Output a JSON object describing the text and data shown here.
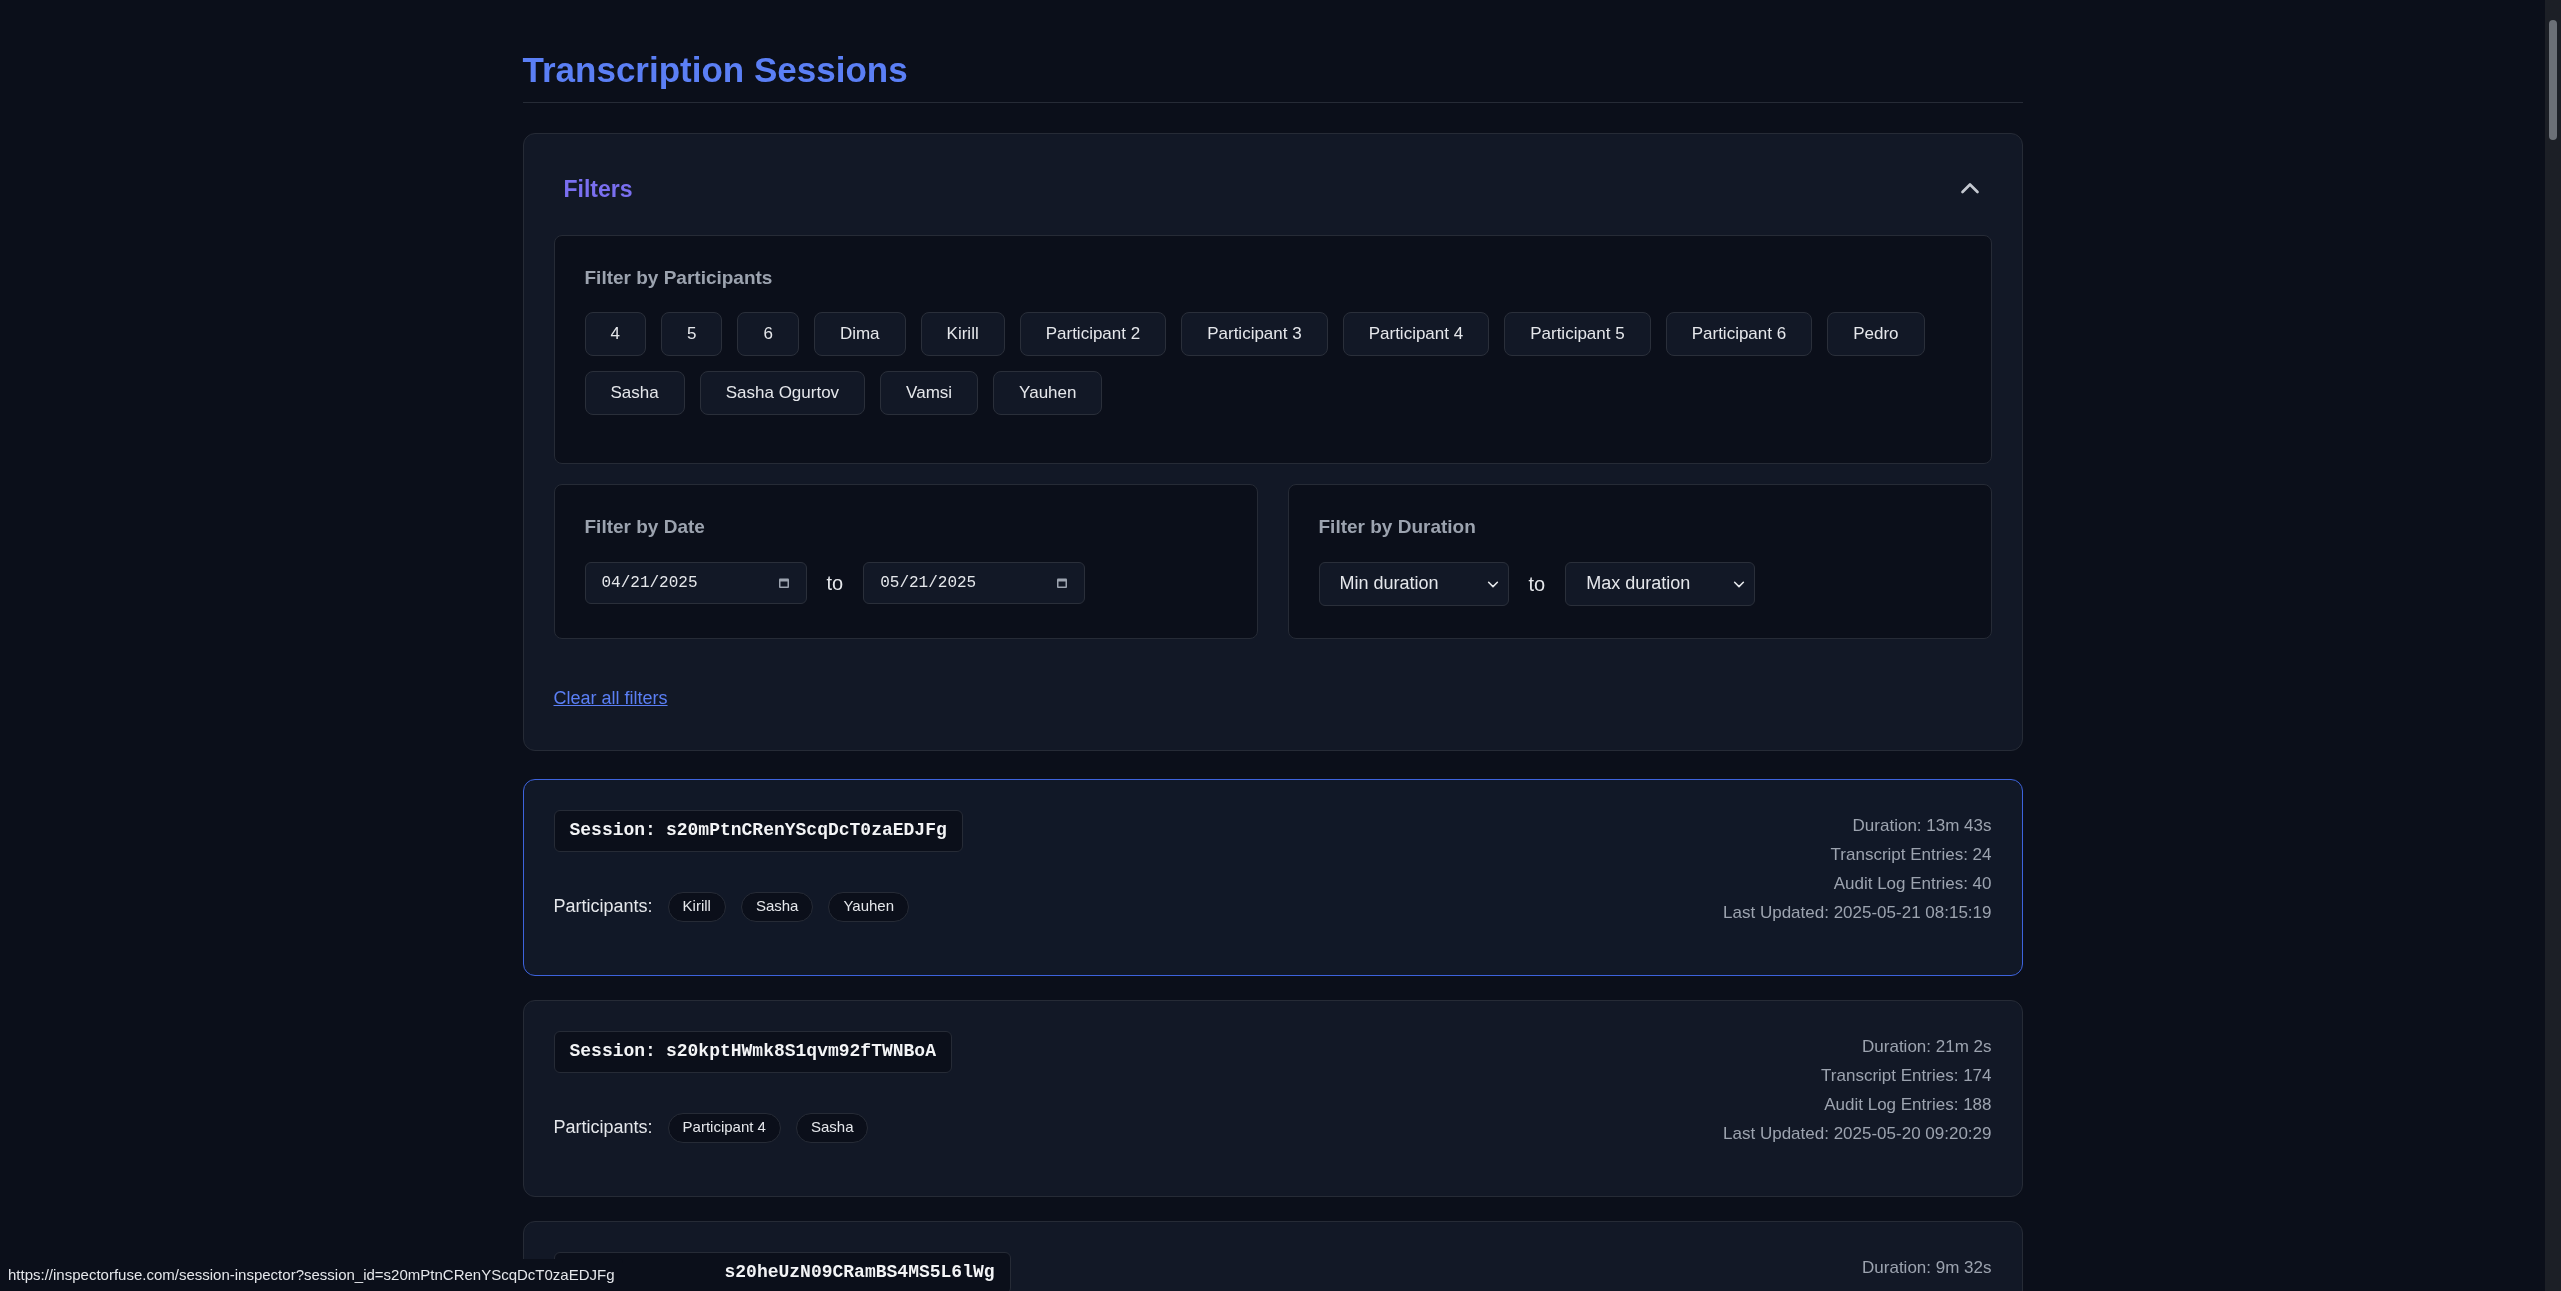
{
  "page_title": "Transcription Sessions",
  "filters": {
    "title": "Filters",
    "expanded": true,
    "participants": {
      "label": "Filter by Participants",
      "options": [
        {
          "label": "4",
          "selected": false
        },
        {
          "label": "5",
          "selected": false
        },
        {
          "label": "6",
          "selected": false
        },
        {
          "label": "Dima",
          "selected": false
        },
        {
          "label": "Kirill",
          "selected": false
        },
        {
          "label": "Participant 2",
          "selected": false
        },
        {
          "label": "Participant 3",
          "selected": false
        },
        {
          "label": "Participant 4",
          "selected": false
        },
        {
          "label": "Participant 5",
          "selected": false
        },
        {
          "label": "Participant 6",
          "selected": false
        },
        {
          "label": "Pedro",
          "selected": false
        },
        {
          "label": "Sasha",
          "selected": false
        },
        {
          "label": "Sasha Ogurtov",
          "selected": false
        },
        {
          "label": "Vamsi",
          "selected": false
        },
        {
          "label": "Yauhen",
          "selected": false
        }
      ]
    },
    "date": {
      "label": "Filter by Date",
      "from": "04/21/2025",
      "separator": "to",
      "to": "05/21/2025"
    },
    "duration": {
      "label": "Filter by Duration",
      "min": "Min duration",
      "separator": "to",
      "max": "Max duration"
    },
    "clear_link": "Clear all filters"
  },
  "sessions": [
    {
      "label": "Session:",
      "id": "s20mPtnCRenYScqDcT0zaEDJFg",
      "highlighted": true,
      "participants_label": "Participants:",
      "participants": [
        "Kirill",
        "Sasha",
        "Yauhen"
      ],
      "stats": [
        "Duration: 13m 43s",
        "Transcript Entries: 24",
        "Audit Log Entries: 40",
        "Last Updated: 2025-05-21 08:15:19"
      ]
    },
    {
      "label": "Session:",
      "id": "s20kptHWmk8S1qvm92fTWNBoA",
      "highlighted": false,
      "participants_label": "Participants:",
      "participants": [
        "Participant 4",
        "Sasha"
      ],
      "stats": [
        "Duration: 21m 2s",
        "Transcript Entries: 174",
        "Audit Log Entries: 188",
        "Last Updated: 2025-05-20 09:20:29"
      ]
    },
    {
      "id": "s20heUzN09CRamBS4MS5L6lWg",
      "highlighted": false,
      "stats": [
        "Duration: 9m 32s"
      ]
    }
  ],
  "status_url": "https://inspectorfuse.com/session-inspector?session_id=s20mPtnCRenYScqDcT0zaEDJFg"
}
